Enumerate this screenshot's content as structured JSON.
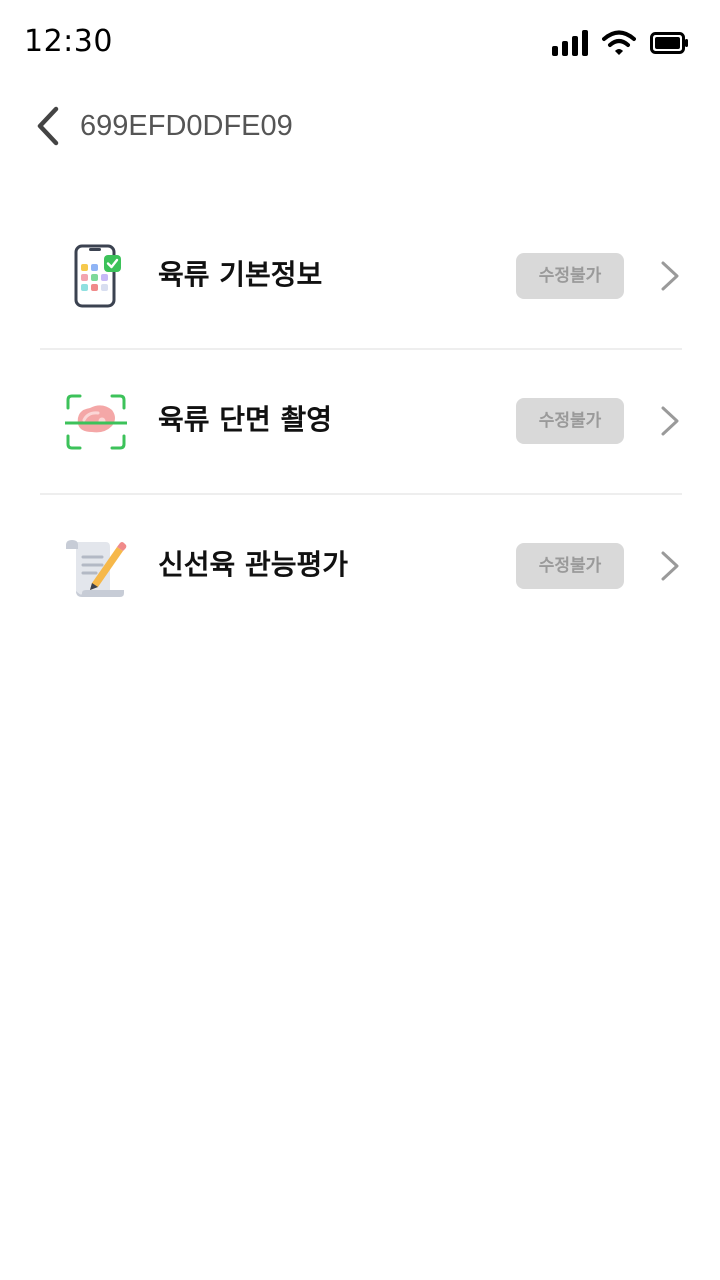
{
  "status_bar": {
    "time": "12:30"
  },
  "header": {
    "title": "699EFD0DFE09"
  },
  "menu": {
    "items": [
      {
        "label": "육류 기본정보",
        "badge": "수정불가",
        "icon": "phone-app-check-icon"
      },
      {
        "label": "육류 단면 촬영",
        "badge": "수정불가",
        "icon": "meat-scan-icon"
      },
      {
        "label": "신선육 관능평가",
        "badge": "수정불가",
        "icon": "evaluation-pencil-icon"
      }
    ]
  },
  "colors": {
    "accent_green": "#3cc25a",
    "badge_bg": "#d9d9d9",
    "badge_text": "#9a9a9a"
  }
}
